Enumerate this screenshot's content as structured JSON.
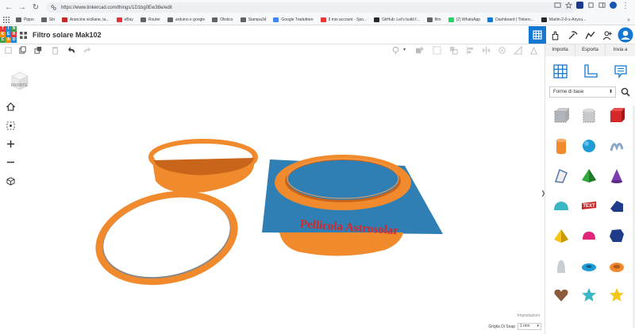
{
  "browser": {
    "url": "https://www.tinkercad.com/things/1D1bg0Ew38e/edit",
    "bookmarks": [
      {
        "label": "Pippo",
        "color": "#5f6368"
      },
      {
        "label": "Siti",
        "color": "#5f6368"
      },
      {
        "label": "Arancine siciliane, la...",
        "color": "#c62828"
      },
      {
        "label": "eBay",
        "color": "#e53238"
      },
      {
        "label": "Router",
        "color": "#5f6368"
      },
      {
        "label": "arduino e google",
        "color": "#5f6368"
      },
      {
        "label": "Olistico",
        "color": "#5f6368"
      },
      {
        "label": "Stampa3d",
        "color": "#5f6368"
      },
      {
        "label": "Google Traduttore",
        "color": "#4285f4"
      },
      {
        "label": "Il mio account - Spo...",
        "color": "#e53935"
      },
      {
        "label": "GitHub: Let's build f...",
        "color": "#24292e"
      },
      {
        "label": "film",
        "color": "#5f6368"
      },
      {
        "label": "(2) WhatsApp",
        "color": "#25d366"
      },
      {
        "label": "Dashboard | Tinkerc...",
        "color": "#1477d1"
      },
      {
        "label": "Marlin-2-0-x-Anycu...",
        "color": "#24292e"
      }
    ],
    "more_label": "»"
  },
  "app": {
    "title": "Filtro solare Mak102",
    "logo_letters": [
      "T",
      "I",
      "N",
      "K",
      "E",
      "R",
      "C",
      "A",
      "D"
    ],
    "logo_colors": [
      "#e53935",
      "#1e88e5",
      "#43a047",
      "#fb8c00",
      "#1e88e5",
      "#e53935",
      "#43a047",
      "#fb8c00",
      "#1e88e5"
    ],
    "accent": "#1477d1"
  },
  "right_tabs": [
    "Importa",
    "Esporta",
    "Invia a"
  ],
  "viewcube": {
    "label": "FRONTE"
  },
  "workplane": {
    "settings_label": "Impostazioni",
    "snap_label": "Griglia Di Snap",
    "snap_value": "1 mm",
    "text_object": "Pellicola Astrosolar",
    "text_color": "#d62828",
    "plate_color": "#2f7fb5",
    "ring_color": "#f08a2c"
  },
  "panel": {
    "category": "Forme di base",
    "shapes": [
      {
        "name": "box-hole-icon",
        "color": "#b0b4bb"
      },
      {
        "name": "cylinder-hole-icon",
        "color": "#c7c9cc"
      },
      {
        "name": "box-icon",
        "color": "#d62828"
      },
      {
        "name": "cylinder-icon",
        "color": "#f08a2c"
      },
      {
        "name": "sphere-icon",
        "color": "#1f9bd6"
      },
      {
        "name": "scribble-icon",
        "color": "#8aa6c8"
      },
      {
        "name": "graphic-icon",
        "color": "#5577aa"
      },
      {
        "name": "pyramid-icon",
        "color": "#2eaa3c"
      },
      {
        "name": "cone-icon",
        "color": "#7c3fb0"
      },
      {
        "name": "roof-icon",
        "color": "#3ab6c4"
      },
      {
        "name": "text-icon",
        "color": "#c62828"
      },
      {
        "name": "wedge-icon",
        "color": "#1f3b8a"
      },
      {
        "name": "pyramid-yellow-icon",
        "color": "#f5c518"
      },
      {
        "name": "half-sphere-icon",
        "color": "#e0267a"
      },
      {
        "name": "polygon-icon",
        "color": "#1f3b8a"
      },
      {
        "name": "paraboloid-icon",
        "color": "#c9ccd1"
      },
      {
        "name": "torus-icon",
        "color": "#1f9bd6"
      },
      {
        "name": "tube-icon",
        "color": "#f08a2c"
      },
      {
        "name": "heart-icon",
        "color": "#8b5a3c"
      },
      {
        "name": "star-icon",
        "color": "#3ab6c4"
      },
      {
        "name": "star-yellow-icon",
        "color": "#f5c518"
      }
    ]
  }
}
